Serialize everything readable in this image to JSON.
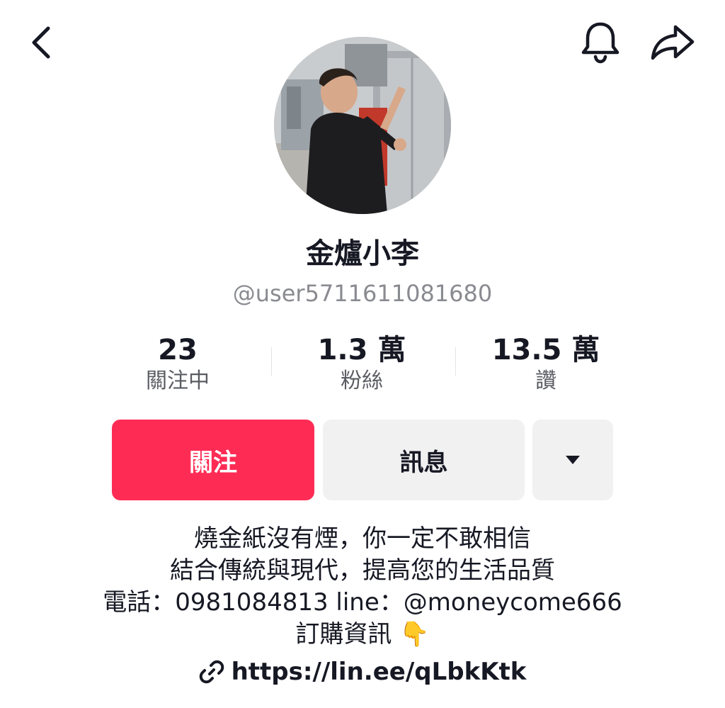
{
  "topbar": {
    "back_icon": "chevron-left-icon",
    "bell_icon": "bell-icon",
    "share_icon": "share-icon"
  },
  "profile": {
    "avatar_alt": "avatar",
    "display_name": "金爐小李",
    "username": "@user5711611081680"
  },
  "stats": [
    {
      "value": "23",
      "label": "關注中"
    },
    {
      "value": "1.3 萬",
      "label": "粉絲"
    },
    {
      "value": "13.5 萬",
      "label": "讚"
    }
  ],
  "actions": {
    "follow_label": "關注",
    "message_label": "訊息",
    "more_icon": "caret-down-icon"
  },
  "bio": {
    "lines": [
      "燒金紙沒有煙，你一定不敢相信",
      "結合傳統與現代，提高您的生活品質",
      "電話：0981084813 line：@moneycome666",
      "訂購資訊 👇"
    ]
  },
  "link": {
    "icon": "link-icon",
    "url": "https://lin.ee/qLbkKtk"
  },
  "colors": {
    "accent": "#fe2c55",
    "button_gray": "#f1f1f2",
    "text": "#161823",
    "muted": "#8a8b91"
  }
}
